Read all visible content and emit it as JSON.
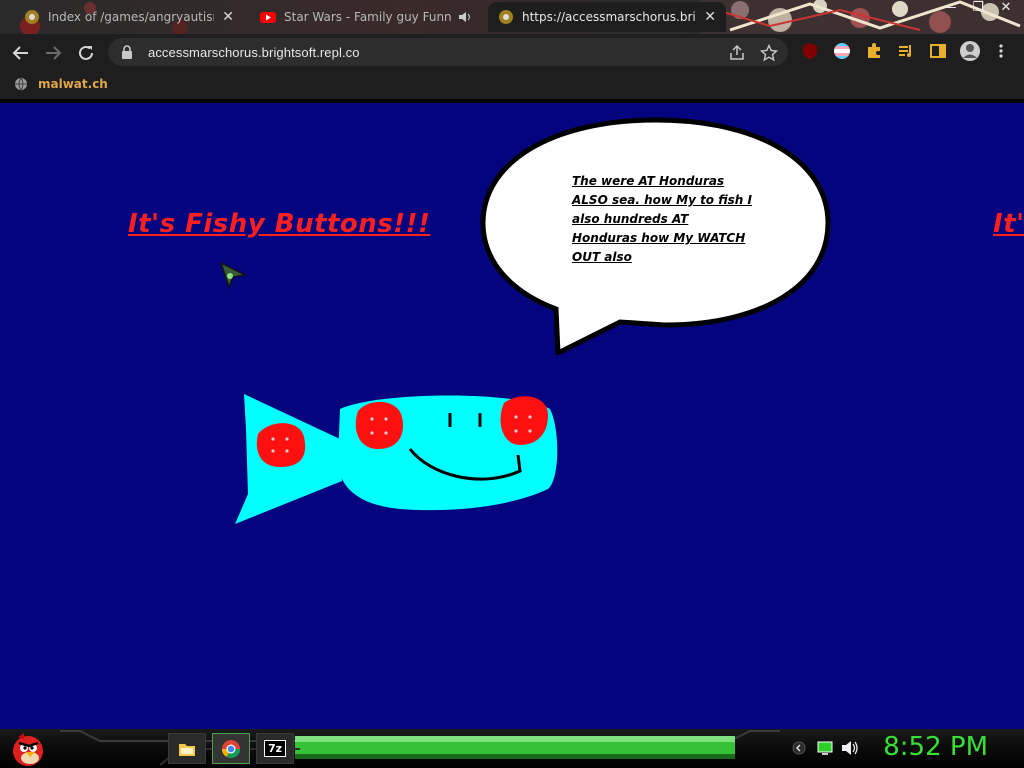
{
  "browser": {
    "tabs": [
      {
        "title": "Index of /games/angryautism/",
        "favicon": "chrome-default-icon"
      },
      {
        "title": "Star Wars - Family guy Funn",
        "favicon": "youtube-icon"
      },
      {
        "title": "https://accessmarschorus.brightsoft",
        "favicon": "chrome-default-icon"
      }
    ],
    "tab_close_glyph": "✕",
    "address_bar": {
      "url": "accessmarschorus.brightsoft.repl.co"
    },
    "window_controls": {
      "minimize": "—",
      "maximize": "❐",
      "close": "✕"
    },
    "bookmarks": [
      {
        "label": "malwat.ch",
        "icon": "globe-icon"
      }
    ],
    "extensions": [
      "ublock-origin-icon",
      "pride-flag-icon",
      "puzzle-extensions-icon",
      "media-playlist-icon",
      "side-panel-icon",
      "profile-avatar-icon"
    ]
  },
  "page": {
    "headline": "It's Fishy Buttons!!!",
    "headline_repeat": "It's",
    "speech_bubble_text": "The were AT Honduras ALSO sea. how My to fish I also hundreds AT Honduras how My WATCH OUT also",
    "colors": {
      "background": "#04047f",
      "headline": "#ff1f1f",
      "fish_body": "#00ffff",
      "fish_spots": "#ff0000"
    }
  },
  "taskbar": {
    "start_icon": "angry-bird-red-icon",
    "pinned": [
      {
        "name": "file-explorer-icon",
        "active": false
      },
      {
        "name": "chrome-icon",
        "active": true
      },
      {
        "name": "7zip-icon",
        "label": "7z",
        "active": false
      }
    ],
    "tray": [
      "chevron-icon",
      "network-monitor-icon",
      "speaker-icon"
    ],
    "clock": "8:52 PM"
  }
}
